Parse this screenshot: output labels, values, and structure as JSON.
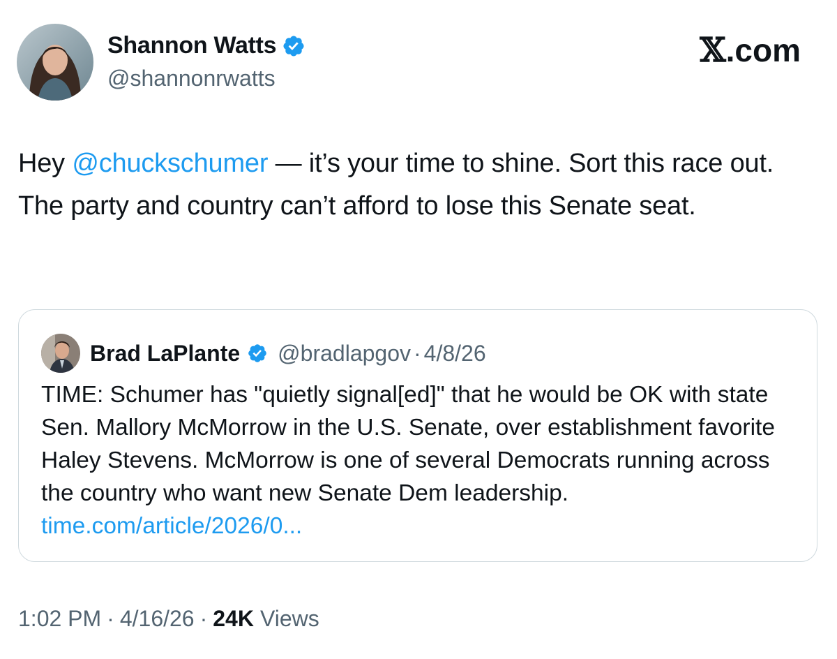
{
  "author": {
    "name": "Shannon Watts",
    "handle": "@shannonrwatts",
    "verified": true,
    "avatar": "profile-photo"
  },
  "brand": {
    "logo_x": "𝕏",
    "logo_suffix": ".com"
  },
  "tweet": {
    "prefix": "Hey ",
    "mention": "@chuckschumer",
    "body": " — it’s your time to shine. Sort this race out. The party and country can’t afford to lose this Senate seat."
  },
  "quote": {
    "author_name": "Brad LaPlante",
    "verified": true,
    "handle": "@bradlapgov",
    "separator": "·",
    "date": "4/8/26",
    "text": "TIME: Schumer has \"quietly signal[ed]\" that he would be OK with state Sen. Mallory McMorrow in the U.S. Senate, over establishment favorite Haley Stevens. McMorrow is one of several Democrats running across the country who want new Senate Dem leadership. ",
    "link": "time.com/article/2026/0..."
  },
  "footer": {
    "time": "1:02 PM",
    "separator": "·",
    "date": "4/16/26",
    "views_count": "24K",
    "views_label": "Views"
  },
  "colors": {
    "link": "#1d9bf0",
    "secondary_text": "#536471",
    "primary_text": "#0f1419",
    "border": "#cfd9de",
    "verified": "#1d9bf0"
  }
}
